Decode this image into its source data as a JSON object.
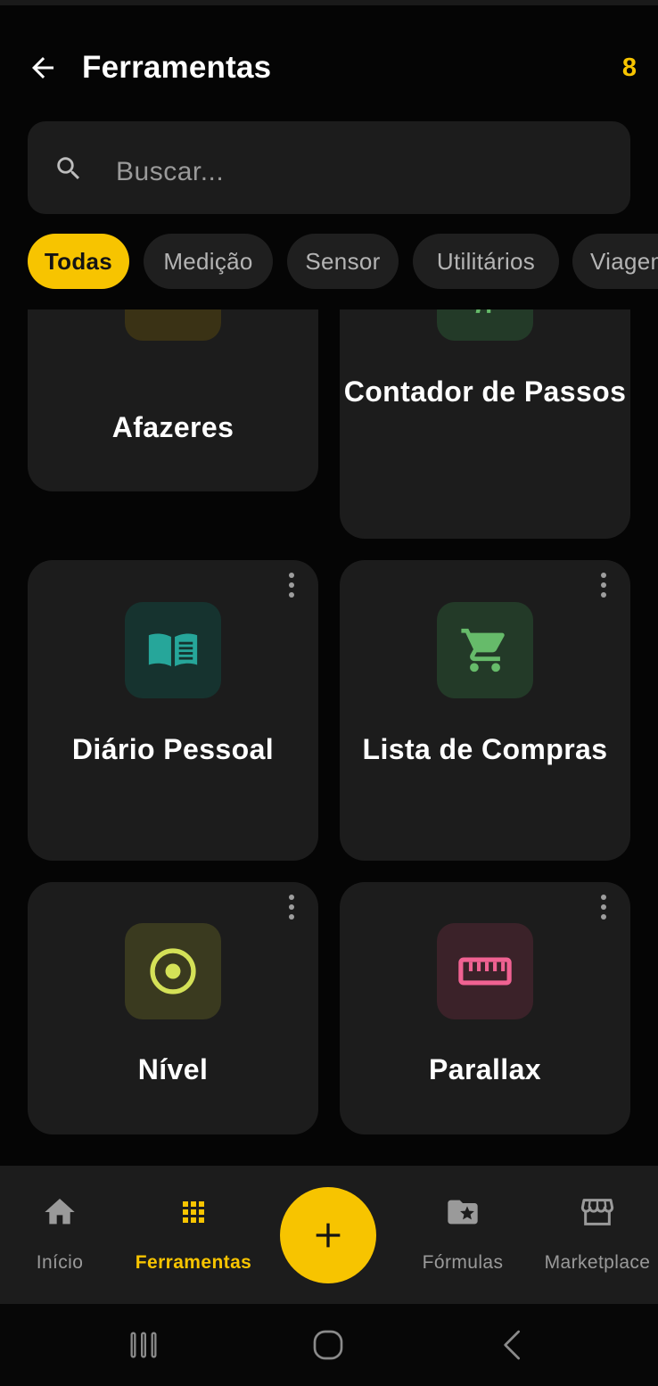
{
  "header": {
    "title": "Ferramentas",
    "count": "8",
    "back_icon": "arrow-left-icon"
  },
  "search": {
    "placeholder": "Buscar...",
    "value": "",
    "icon": "search-icon"
  },
  "filters": [
    {
      "label": "Todas",
      "active": true
    },
    {
      "label": "Medição",
      "active": false
    },
    {
      "label": "Sensor",
      "active": false
    },
    {
      "label": "Utilitários",
      "active": false
    },
    {
      "label": "Viagem",
      "active": false
    }
  ],
  "tools": [
    {
      "label": "Afazeres",
      "icon": "checklist-icon",
      "icon_color": "#f7c400",
      "tile_color": "#3a3215"
    },
    {
      "label": "Contador de Passos",
      "icon": "walking-person-icon",
      "icon_color": "#66bb6a",
      "tile_color": "#233a28"
    },
    {
      "label": "Diário Pessoal",
      "icon": "open-book-icon",
      "icon_color": "#26a69a",
      "tile_color": "#16332f"
    },
    {
      "label": "Lista de Compras",
      "icon": "shopping-cart-icon",
      "icon_color": "#66bb6a",
      "tile_color": "#233a28"
    },
    {
      "label": "Nível",
      "icon": "level-target-icon",
      "icon_color": "#d4e157",
      "tile_color": "#3a3a1f"
    },
    {
      "label": "Parallax",
      "icon": "ruler-icon",
      "icon_color": "#f06292",
      "tile_color": "#3b2229"
    }
  ],
  "bottom_nav": [
    {
      "label": "Início",
      "icon": "home-icon",
      "active": false
    },
    {
      "label": "Ferramentas",
      "icon": "grid-icon",
      "active": true
    },
    {
      "label": "Fórmulas",
      "icon": "folder-star-icon",
      "active": false
    },
    {
      "label": "Marketplace",
      "icon": "storefront-icon",
      "active": false
    }
  ],
  "fab": {
    "icon": "plus-icon"
  },
  "system_nav": {
    "recents_icon": "recents-icon",
    "home_icon": "home-pill-icon",
    "back_icon": "back-chevron-icon"
  },
  "colors": {
    "accent": "#f7c400",
    "background": "#050505",
    "surface": "#1c1c1c",
    "muted_text": "#9a9a9a"
  }
}
